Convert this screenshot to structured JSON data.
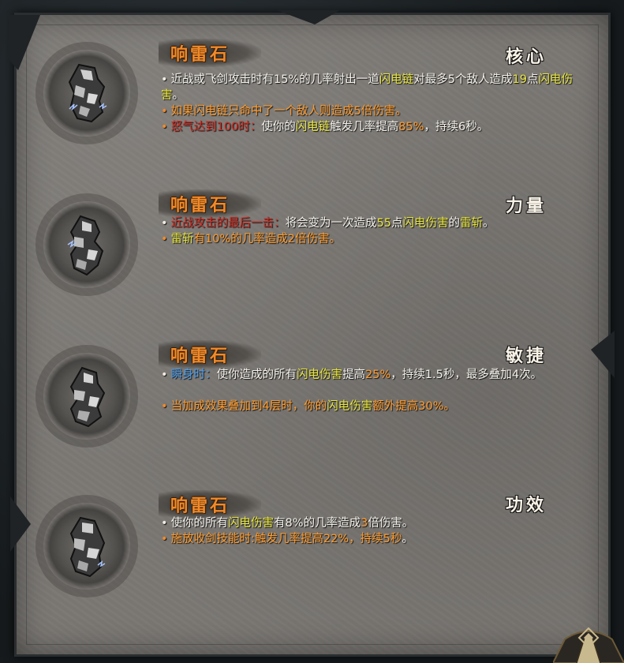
{
  "panel": {
    "entries": [
      {
        "title": "响雷石",
        "slot": "核心",
        "icon": "lightning-stone-icon",
        "lines": [
          {
            "parts": [
              "近战或飞剑攻击时有15%的几率射出一道",
              "闪电链",
              "对最多5个敌人造成",
              "19",
              "点",
              "闪电伤害",
              "。"
            ]
          },
          {
            "parts": [
              "如果",
              "闪电链",
              "只命中了一个敌人则造成",
              "5",
              "倍伤害。"
            ]
          },
          {
            "parts": [
              "怒气达到100时：",
              "使你的",
              "闪电链",
              "触发几率提高",
              "85%",
              "，持续6秒。"
            ]
          }
        ]
      },
      {
        "title": "响雷石",
        "slot": "力量",
        "icon": "lightning-stone-icon",
        "lines": [
          {
            "parts": [
              "近战攻击的最后一击：",
              "将会变为一次造成",
              "55",
              "点",
              "闪电伤害",
              "的",
              "雷斩",
              "。"
            ]
          },
          {
            "parts": [
              "雷斩",
              "有10%的几率造成",
              "2",
              "倍伤害。"
            ]
          }
        ]
      },
      {
        "title": "响雷石",
        "slot": "敏捷",
        "icon": "lightning-stone-icon",
        "lines": [
          {
            "parts": [
              "瞬身时：",
              "使你造成的所有",
              "闪电伤害",
              "提高",
              "25%",
              "，持续1.5秒，最多叠加4次。"
            ]
          },
          {
            "parts": [
              "当加成效果叠加到4层时，你的",
              "闪电伤害",
              "额外提高30%。"
            ]
          }
        ]
      },
      {
        "title": "响雷石",
        "slot": "功效",
        "icon": "lightning-stone-icon",
        "lines": [
          {
            "parts": [
              "使你的所有",
              "闪电伤害",
              "有8%的几率造成",
              "3",
              "倍伤害。"
            ]
          },
          {
            "parts": [
              "施放收剑技能时:触发几率提高22%，持续5秒",
              "。"
            ]
          }
        ]
      }
    ]
  }
}
